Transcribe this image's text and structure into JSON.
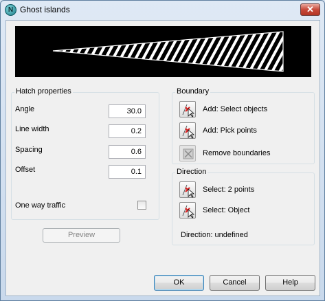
{
  "window": {
    "title": "Ghost islands",
    "app_icon_letter": "N",
    "close_glyph": "✕"
  },
  "hatch": {
    "group_title": "Hatch properties",
    "fields": [
      {
        "label": "Angle",
        "value": "30.0"
      },
      {
        "label": "Line width",
        "value": "0.2"
      },
      {
        "label": "Spacing",
        "value": "0.6"
      },
      {
        "label": "Offset",
        "value": "0.1"
      }
    ],
    "one_way_label": "One way traffic",
    "one_way_checked": false,
    "preview_button": "Preview"
  },
  "boundary": {
    "group_title": "Boundary",
    "actions": [
      {
        "label": "Add: Select objects",
        "icon": "select-objects-icon"
      },
      {
        "label": "Add: Pick points",
        "icon": "pick-points-icon"
      },
      {
        "label": "Remove boundaries",
        "icon": "remove-boundaries-icon"
      }
    ]
  },
  "direction": {
    "group_title": "Direction",
    "actions": [
      {
        "label": "Select: 2 points",
        "icon": "select-two-points-icon"
      },
      {
        "label": "Select: Object",
        "icon": "select-object-icon"
      }
    ],
    "status": "Direction: undefined"
  },
  "buttons": {
    "ok": "OK",
    "cancel": "Cancel",
    "help": "Help"
  },
  "colors": {
    "accent_default_button": "#3c7fb1",
    "close_button": "#c8493a",
    "preview_bg": "#000000"
  }
}
